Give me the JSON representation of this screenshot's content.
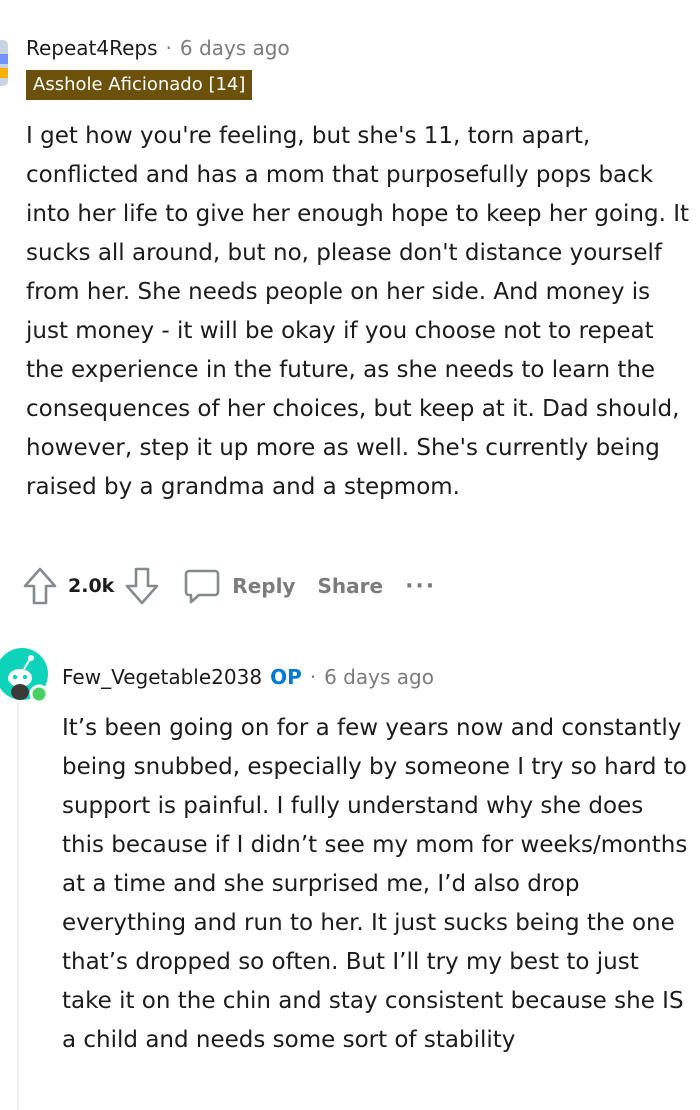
{
  "comment1": {
    "author": "Repeat4Reps",
    "separator": "·",
    "time": "6 days ago",
    "flair": "Asshole Aficionado [14]",
    "body": "I get how you're feeling, but she's 11, torn apart, conflicted and has a mom that purposefully pops back into her life to give her enough hope to keep her going. It sucks all around, but no, please don't distance yourself from her. She needs people on her side. And money is just money - it will be okay if you choose not to repeat the experience in the future, as she needs to learn the consequences of her choices, but keep at it. Dad should, however, step it up more as well. She's currently being raised by a grandma and a stepmom.",
    "score": "2.0k",
    "reply_label": "Reply",
    "share_label": "Share",
    "more_label": "···"
  },
  "comment2": {
    "author": "Few_Vegetable2038",
    "op_badge": "OP",
    "separator": "·",
    "time": "6 days ago",
    "body": "It’s been going on for a few years now and constantly being snubbed, especially by someone I try so hard to support is painful. I fully understand why she does this because if I didn’t see my mom for weeks/months at a time and she surprised me, I’d also drop everything and run to her. It just sucks being the one that’s dropped so often. But I’ll try my best to just take it on the chin and stay consistent because she IS a child and needs some sort of stability"
  },
  "colors": {
    "flair_bg": "#6b5109",
    "muted_text": "#7c7c7c",
    "op_blue": "#0079d3",
    "avatar_teal": "#0dd3bb",
    "online_green": "#46d160"
  },
  "icons": [
    "avatar-icon",
    "upvote-icon",
    "downvote-icon",
    "reply-icon",
    "more-options-icon",
    "snoo-avatar-icon",
    "online-indicator-icon"
  ]
}
